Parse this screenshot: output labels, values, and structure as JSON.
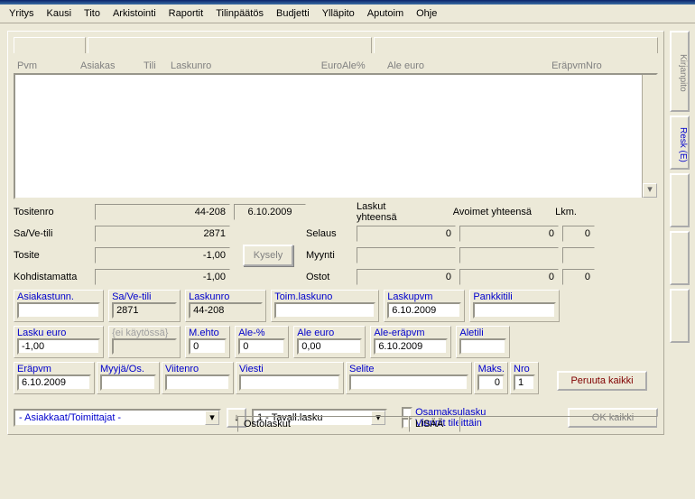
{
  "menu": [
    "Yritys",
    "Kausi",
    "Tito",
    "Arkistointi",
    "Raportit",
    "Tilinpäätös",
    "Budjetti",
    "Ylläpito",
    "Aputoim",
    "Ohje"
  ],
  "grid_headers": {
    "pvm": "Pvm",
    "asiakas": "Asiakas",
    "tili": "Tili",
    "laskunro": "Laskunro",
    "euro": "Euro",
    "alepct": "Ale%",
    "aleeuro": "Ale euro",
    "erapvm": "Eräpvm",
    "nro": "Nro"
  },
  "summary": {
    "tositenro_lbl": "Tositenro",
    "tositenro_val": "44-208",
    "tositenro_date": "6.10.2009",
    "savetili_lbl": "Sa/Ve-tili",
    "savetili_val": "2871",
    "tosite_lbl": "Tosite",
    "tosite_val": "-1,00",
    "kohdistamatta_lbl": "Kohdistamatta",
    "kohdistamatta_val": "-1,00",
    "kysely_btn": "Kysely",
    "laskut_lbl": "Laskut yhteensä",
    "avoimet_lbl": "Avoimet yhteensä",
    "lkm_lbl": "Lkm.",
    "selaus_lbl": "Selaus",
    "selaus_l": "0",
    "selaus_a": "0",
    "selaus_lkm": "0",
    "myynti_lbl": "Myynti",
    "ostot_lbl": "Ostot",
    "ostot_l": "0",
    "ostot_a": "0",
    "ostot_lkm": "0"
  },
  "fields": {
    "asiakastunn": "Asiakastunn.",
    "asiakastunn_val": "",
    "savetili": "Sa/Ve-tili",
    "savetili_val": "2871",
    "laskunro": "Laskunro",
    "laskunro_val": "44-208",
    "toimlaskuno": "Toim.laskuno",
    "toimlaskuno_val": "",
    "laskupvm": "Laskupvm",
    "laskupvm_val": "6.10.2009",
    "pankkitili": "Pankkitili",
    "pankkitili_val": "",
    "laskueuro": "Lasku euro",
    "laskueuro_val": "-1,00",
    "eikaytossa": "{ei käytössä}",
    "eikaytossa_val": "",
    "mehto": "M.ehto",
    "mehto_val": "0",
    "alepct": "Ale-%",
    "alepct_val": "0",
    "aleeuro": "Ale euro",
    "aleeuro_val": "0,00",
    "aleerapvm": "Ale-eräpvm",
    "aleerapvm_val": "6.10.2009",
    "aletili": "Aletili",
    "aletili_val": "",
    "erapvm": "Eräpvm",
    "erapvm_val": "6.10.2009",
    "myyjaos": "Myyjä/Os.",
    "myyjaos_val": "",
    "viitenro": "Viitenro",
    "viitenro_val": "",
    "viesti": "Viesti",
    "viesti_val": "",
    "selite": "Selite",
    "selite_val": "",
    "maks": "Maks.",
    "maks_val": "0",
    "nro": "Nro",
    "nro_val": "1"
  },
  "actions": {
    "peruuta": "Peruuta kaikki",
    "ok": "OK kaikki"
  },
  "bottom": {
    "asiakkaat": "- Asiakkaat/Toimittajat -",
    "lasku_type": "1 - Tavall.lasku",
    "osamaksulasku": "Osamaksulasku",
    "viennit": "Viennit tileittäin",
    "status1": "Ostolaskut",
    "status2": "LISÄÄ"
  },
  "side": {
    "kirjanpito": "Kirjanpito",
    "resk": "Resk (E)"
  }
}
